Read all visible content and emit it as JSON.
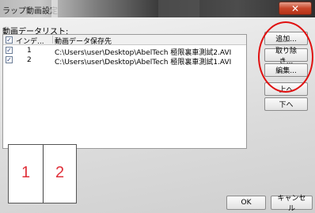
{
  "window": {
    "title": "ラップ動画設定",
    "close_label": "✕"
  },
  "list": {
    "label": "動画データリスト:",
    "columns": [
      "インデ...",
      "動画データ保存先"
    ],
    "rows": [
      {
        "checked": true,
        "index": "1",
        "path": "C:\\Users\\user\\Desktop\\AbelTech 極限裏車測試2.AVI"
      },
      {
        "checked": true,
        "index": "2",
        "path": "C:\\Users\\user\\Desktop\\AbelTech 極限裏車測試1.AVI"
      }
    ]
  },
  "side_buttons": {
    "add": "追加...",
    "remove": "取り除き...",
    "edit": "編集...",
    "up": "上へ",
    "down": "下へ"
  },
  "preview": {
    "left_number": "1",
    "right_number": "2"
  },
  "footer": {
    "ok": "OK",
    "cancel": "キャンセル"
  }
}
